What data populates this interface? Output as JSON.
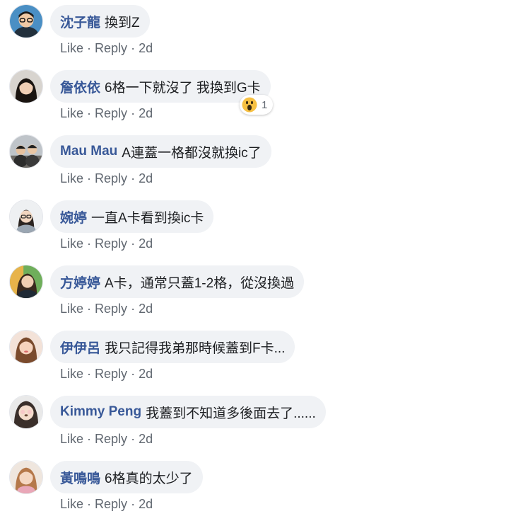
{
  "action_labels": {
    "like": "Like",
    "reply": "Reply",
    "separator": "·"
  },
  "comments": [
    {
      "author": "沈子龍",
      "text": "換到Z",
      "time": "2d"
    },
    {
      "author": "詹依依",
      "text": "6格一下就沒了 我換到G卡",
      "time": "2d",
      "reaction": {
        "emoji": "wow",
        "count": "1"
      }
    },
    {
      "author": "Mau Mau",
      "text": "A連蓋一格都沒就換ic了",
      "time": "2d"
    },
    {
      "author": "婉婷",
      "text": "一直A卡看到換ic卡",
      "time": "2d"
    },
    {
      "author": "方婷婷",
      "text": "A卡，通常只蓋1-2格，從沒換過",
      "time": "2d"
    },
    {
      "author": "伊伊呂",
      "text": "我只記得我弟那時候蓋到F卡...",
      "time": "2d"
    },
    {
      "author": "Kimmy Peng",
      "text": "我蓋到不知道多後面去了......",
      "time": "2d"
    },
    {
      "author": "黃鳴鳴",
      "text": "6格真的太少了",
      "time": "2d"
    }
  ],
  "colors": {
    "author": "#385898",
    "bubble": "#f0f2f5",
    "meta": "#606770",
    "text": "#1c1e21"
  }
}
